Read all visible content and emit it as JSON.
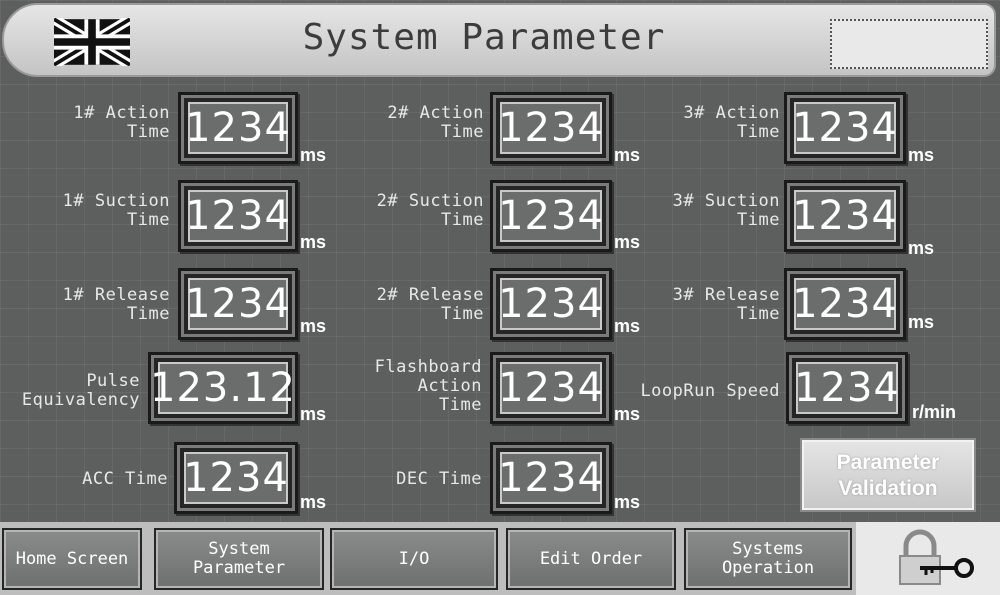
{
  "header": {
    "title": "System Parameter",
    "language_flag": "uk-flag-icon"
  },
  "params": {
    "action1": {
      "label": "1# Action\nTime",
      "value": "1234",
      "unit": "ms"
    },
    "action2": {
      "label": "2# Action\nTime",
      "value": "1234",
      "unit": "ms"
    },
    "action3": {
      "label": "3# Action\nTime",
      "value": "1234",
      "unit": "ms"
    },
    "suction1": {
      "label": "1# Suction\nTime",
      "value": "1234",
      "unit": "ms"
    },
    "suction2": {
      "label": "2# Suction\nTime",
      "value": "1234",
      "unit": "ms"
    },
    "suction3": {
      "label": "3# Suction\nTime",
      "value": "1234",
      "unit": "ms"
    },
    "release1": {
      "label": "1# Release\nTime",
      "value": "1234",
      "unit": "ms"
    },
    "release2": {
      "label": "2# Release\nTime",
      "value": "1234",
      "unit": "ms"
    },
    "release3": {
      "label": "3# Release\nTime",
      "value": "1234",
      "unit": "ms"
    },
    "pulse": {
      "label": "Pulse\nEquivalency",
      "value": "123.12",
      "unit": "ms"
    },
    "flashboard": {
      "label": "Flashboard\nAction\nTime",
      "value": "1234",
      "unit": "ms"
    },
    "looprun": {
      "label": "LoopRun Speed",
      "value": "1234",
      "unit": "r/min"
    },
    "acc": {
      "label": "ACC Time",
      "value": "1234",
      "unit": "ms"
    },
    "dec": {
      "label": "DEC Time",
      "value": "1234",
      "unit": "ms"
    }
  },
  "validate_button": "Parameter\nValidation",
  "nav": {
    "home": "Home Screen",
    "system_parameter": "System\nParameter",
    "io": "I/O",
    "edit_order": "Edit Order",
    "systems_operation": "Systems\nOperation",
    "lock": "padlock-key-icon"
  },
  "colors": {
    "panel": "#5d5f5f",
    "header": "#d6d6d6",
    "field_value_bg": "#6b6d6d"
  }
}
